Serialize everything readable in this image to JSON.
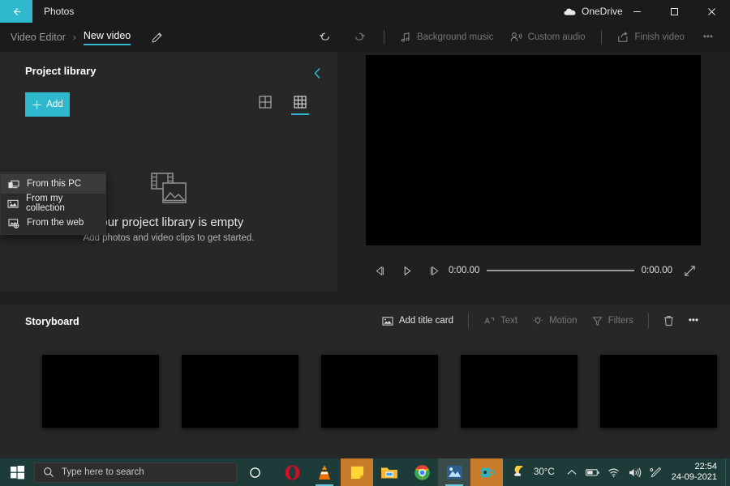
{
  "titlebar": {
    "app_name": "Photos",
    "back_icon": "back-arrow-icon",
    "onedrive_label": "OneDrive",
    "onedrive_icon": "cloud-icon",
    "minimize_label": "—",
    "maximize_label": "☐",
    "close_label": "✕",
    "accent_color": "#2fb8cd"
  },
  "commandbar": {
    "breadcrumb_root": "Video Editor",
    "breadcrumb_sep": "›",
    "breadcrumb_current": "New video",
    "rename_icon": "pencil-icon",
    "undo_icon": "undo-icon",
    "redo_icon": "redo-icon",
    "background_music": "Background music",
    "custom_audio": "Custom audio",
    "finish_video": "Finish video",
    "more_label": "•••"
  },
  "library": {
    "title": "Project library",
    "collapse_icon": "chevron-left-icon",
    "add_label": "Add",
    "view_grid_large": "grid-large-icon",
    "view_grid_small": "grid-small-icon",
    "empty_icon": "film-photo-icon",
    "empty_title": "Your project library is empty",
    "empty_subtitle": "Add photos and video clips to get started."
  },
  "add_menu": {
    "items": [
      {
        "label": "From this PC",
        "icon": "pc-icon",
        "highlighted": true
      },
      {
        "label": "From my collection",
        "icon": "collection-icon",
        "highlighted": false
      },
      {
        "label": "From the web",
        "icon": "web-image-icon",
        "highlighted": false
      }
    ]
  },
  "preview": {
    "prev_frame_icon": "previous-frame-icon",
    "play_icon": "play-icon",
    "next_frame_icon": "next-frame-icon",
    "current_time": "0:00.00",
    "total_time": "0:00.00",
    "fullscreen_icon": "fullscreen-icon",
    "progress_percent": 0
  },
  "storyboard": {
    "title": "Storyboard",
    "add_title_card": "Add title card",
    "text_label": "Text",
    "motion_label": "Motion",
    "filters_label": "Filters",
    "delete_icon": "trash-icon",
    "more_label": "•••",
    "cards": [
      {
        "index": 1
      },
      {
        "index": 2
      },
      {
        "index": 3
      },
      {
        "index": 4
      },
      {
        "index": 5
      }
    ]
  },
  "taskbar": {
    "start_icon": "windows-start-icon",
    "search_placeholder": "Type here to search",
    "search_icon": "search-icon",
    "search_value": "",
    "cortana_icon": "cortana-circle-icon",
    "apps": [
      {
        "name": "opera-icon"
      },
      {
        "name": "vlc-icon"
      },
      {
        "name": "sticky-notes-icon"
      },
      {
        "name": "file-explorer-icon"
      },
      {
        "name": "chrome-icon"
      },
      {
        "name": "photos-icon"
      },
      {
        "name": "mug-app-icon"
      }
    ],
    "weather_icon": "night-moon-icon",
    "temperature": "30°C",
    "chevron_up_icon": "chevron-up-icon",
    "battery_icon": "battery-icon",
    "wifi_icon": "wifi-icon",
    "volume_icon": "volume-icon",
    "pen_icon": "pen-icon",
    "time": "22:54",
    "date": "24-09-2021"
  }
}
